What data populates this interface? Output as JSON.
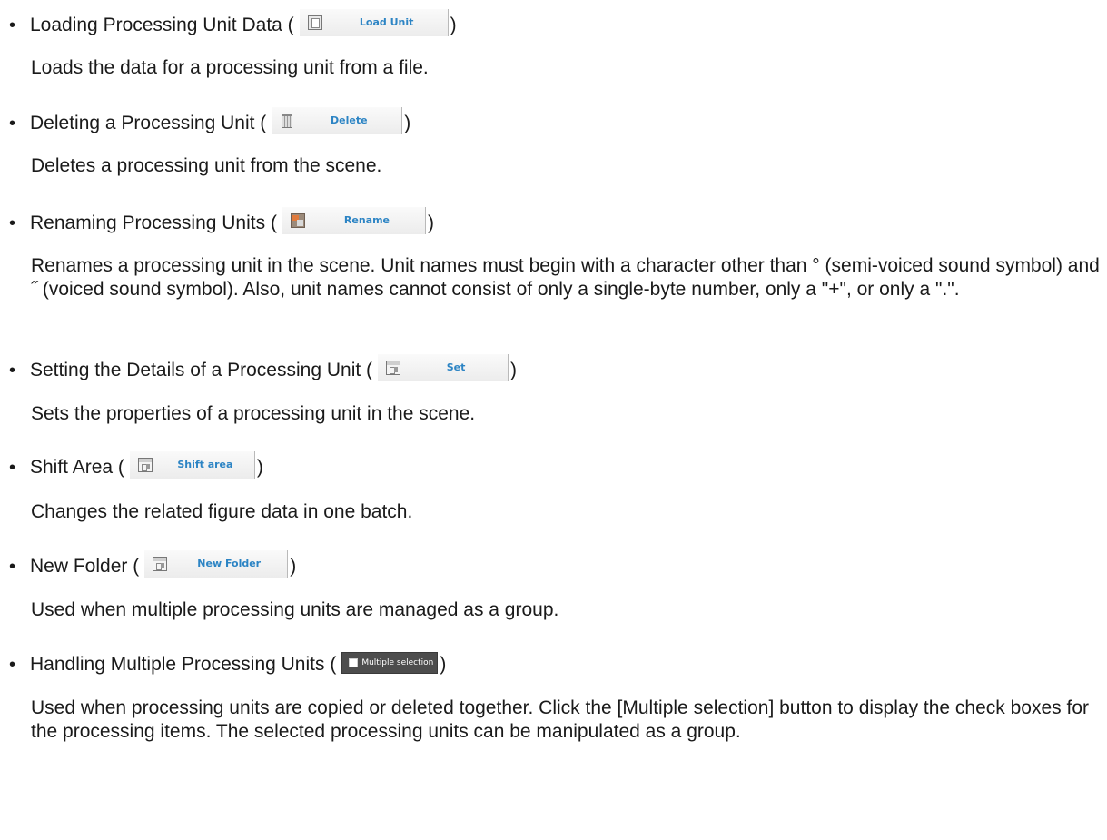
{
  "items": [
    {
      "heading": "Loading Processing Unit Data (",
      "button": {
        "label": "Load Unit",
        "icon": "load-unit-icon"
      },
      "close": ")",
      "description": "Loads the data for a processing unit from a file."
    },
    {
      "heading": "Deleting a Processing Unit (",
      "button": {
        "label": "Delete",
        "icon": "trash-icon"
      },
      "close": ")",
      "description": "Deletes a processing unit from the scene."
    },
    {
      "heading": "Renaming Processing Units (",
      "button": {
        "label": "Rename",
        "icon": "rename-icon"
      },
      "close": ")",
      "description": "Renames a processing unit in the scene. Unit names must begin with a character other than ° (semi-voiced sound symbol) and ˝ (voiced sound symbol). Also, unit names cannot consist of only a single-byte number, only a \"+\", or only a \".\"."
    },
    {
      "heading": "Setting the Details of a Processing Unit (",
      "button": {
        "label": "Set",
        "icon": "settings-icon"
      },
      "close": ")",
      "description": "Sets the properties of a processing unit in the scene."
    },
    {
      "heading": "Shift Area (",
      "button": {
        "label": "Shift area",
        "icon": "shift-area-icon"
      },
      "close": ")",
      "description": "Changes the related figure data in one batch."
    },
    {
      "heading": "New Folder (",
      "button": {
        "label": "New Folder",
        "icon": "new-folder-icon"
      },
      "close": ")",
      "description": "Used when multiple processing units are managed as a group."
    },
    {
      "heading": "Handling Multiple Processing Units (",
      "button": {
        "label": "Multiple selection",
        "icon": "checkbox-icon"
      },
      "close": ")",
      "description": "Used when processing units are copied or deleted together. Click the [Multiple selection] button to display the check boxes for the processing items. The selected processing units can be manipulated as a group."
    }
  ],
  "bullet": "•",
  "colors": {
    "button_label": "#2c84c4",
    "dark_button_bg": "#4d4d4d",
    "text": "#1a1a1a"
  }
}
